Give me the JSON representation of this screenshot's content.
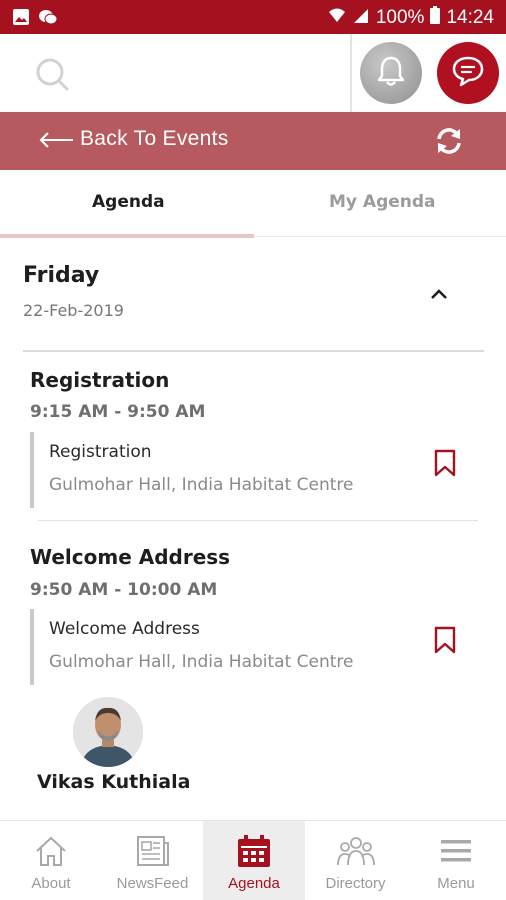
{
  "status_bar": {
    "battery": "100%",
    "time": "14:24"
  },
  "header": {
    "back_label": "Back To Events"
  },
  "tabs": [
    {
      "label": "Agenda",
      "active": true
    },
    {
      "label": "My Agenda",
      "active": false
    }
  ],
  "day": {
    "title": "Friday",
    "date": "22-Feb-2019",
    "expanded": true
  },
  "sessions": [
    {
      "title": "Registration",
      "time": "9:15 AM - 9:50 AM",
      "name": "Registration",
      "venue": "Gulmohar Hall, India Habitat Centre"
    },
    {
      "title": "Welcome Address",
      "time": "9:50 AM - 10:00 AM",
      "name": "Welcome Address",
      "venue": "Gulmohar Hall, India Habitat Centre",
      "speaker": "Vikas Kuthiala"
    }
  ],
  "bottom_nav": [
    {
      "label": "About",
      "icon": "home-icon",
      "active": false
    },
    {
      "label": "NewsFeed",
      "icon": "newspaper-icon",
      "active": false
    },
    {
      "label": "Agenda",
      "icon": "calendar-icon",
      "active": true
    },
    {
      "label": "Directory",
      "icon": "people-icon",
      "active": false
    },
    {
      "label": "Menu",
      "icon": "hamburger-menu-icon",
      "active": false
    }
  ],
  "colors": {
    "brand": "#a5111f",
    "back_bar": "#b65a5f",
    "active_tab_indicator": "#e6c6c6"
  }
}
